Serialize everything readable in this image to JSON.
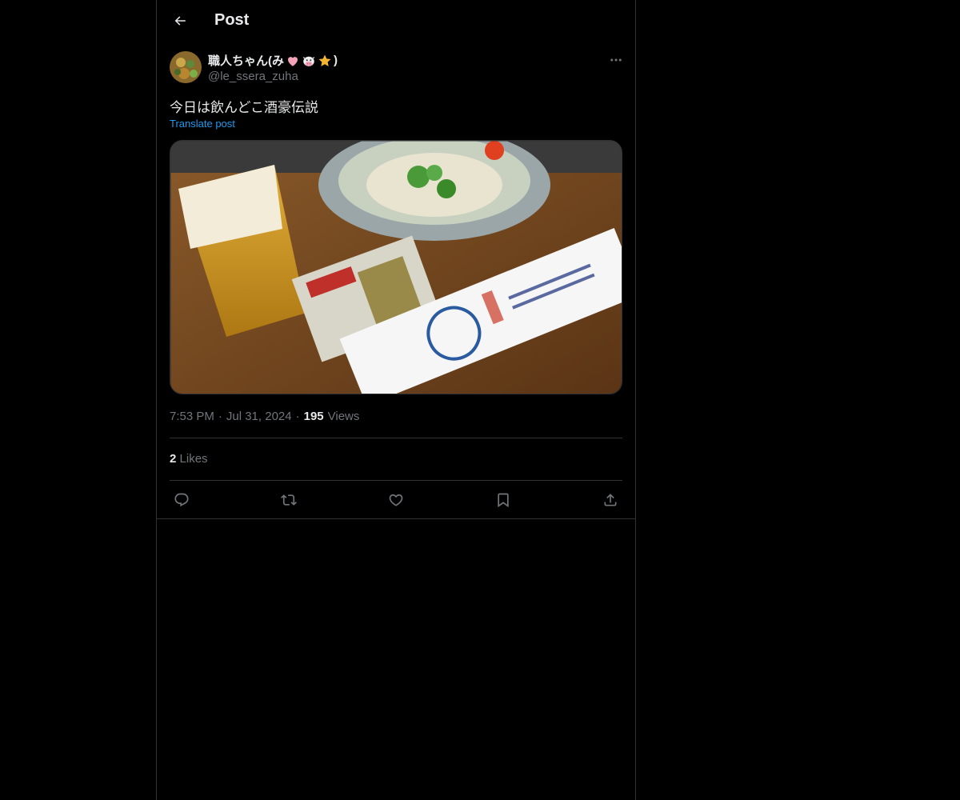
{
  "header": {
    "title": "Post",
    "back_icon": "arrow-left-icon"
  },
  "post": {
    "author": {
      "display_name": "職人ちゃん(み",
      "display_name_end": ")",
      "name_emojis": [
        "pink-heart-icon",
        "cow-face-icon",
        "star-icon"
      ],
      "handle": "@le_ssera_zuha"
    },
    "text": "今日は飲んどこ酒豪伝説",
    "translate_label": "Translate post",
    "media_description": "food-photo",
    "time": "7:53 PM",
    "date": "Jul 31, 2024",
    "separator": "·",
    "views_count": "195",
    "views_label": "Views",
    "likes_count": "2",
    "likes_label": "Likes"
  },
  "actions": [
    "reply-icon",
    "repost-icon",
    "like-icon",
    "bookmark-icon",
    "share-icon"
  ],
  "colors": {
    "background": "#000000",
    "text": "#e7e9ea",
    "secondary": "#71767b",
    "link": "#1d9bf0",
    "border": "#2f3336"
  }
}
